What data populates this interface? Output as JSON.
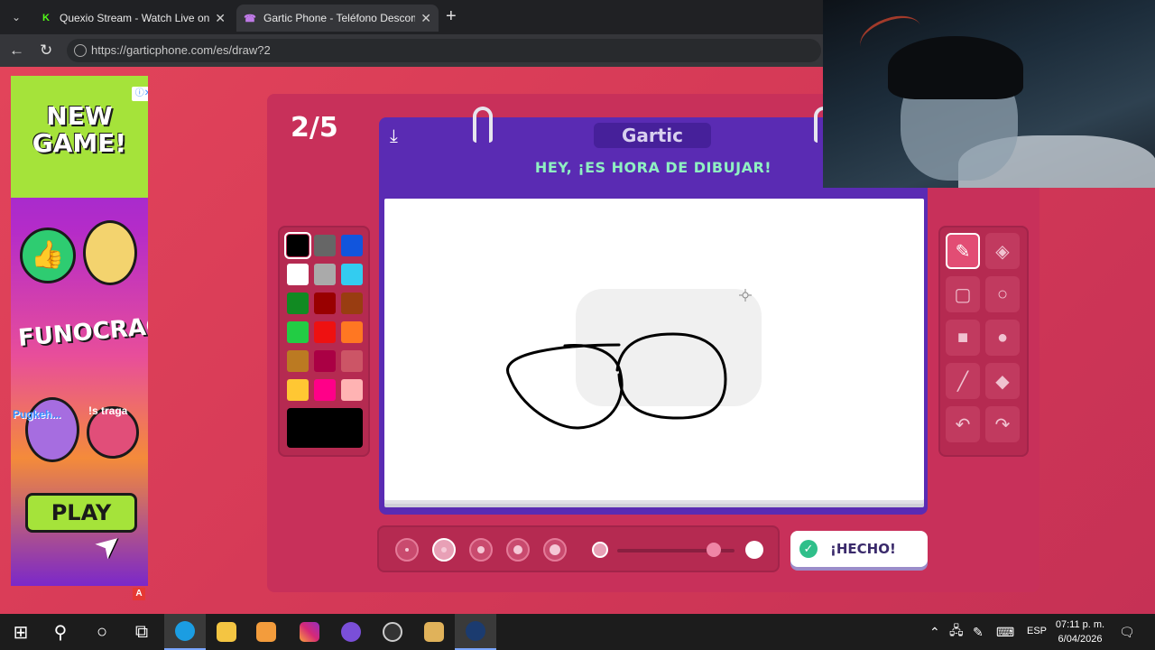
{
  "browser": {
    "tabs": [
      {
        "title": "Quexio Stream - Watch Live on Kic",
        "favicon": "K",
        "favicon_color": "#53fc18",
        "active": false
      },
      {
        "title": "Gartic Phone - Teléfono Descompu",
        "favicon": "☎",
        "favicon_color": "#a25ce0",
        "active": true
      }
    ],
    "url": "https://garticphone.com/es/draw?2"
  },
  "ad": {
    "headline": "NEW GAME!",
    "logo_text": "FUNOCRACY",
    "tag_left": "Pugkeh...",
    "tag_right": "!s traga",
    "play_label": "PLAY",
    "badge": "A"
  },
  "game": {
    "round": "2/5",
    "brand": "Gartic",
    "instruction": "HEY, ¡ES HORA DE DIBUJAR!",
    "done_label": "¡HECHO!",
    "palette": [
      [
        "#000000",
        "#666666",
        "#1155dd"
      ],
      [
        "#ffffff",
        "#aaaaaa",
        "#33ccf0"
      ],
      [
        "#118a22",
        "#990000",
        "#993d11"
      ],
      [
        "#22cc44",
        "#ee1111",
        "#ff7722"
      ],
      [
        "#bb7a22",
        "#aa0044",
        "#cc5566"
      ],
      [
        "#ffc733",
        "#ff0088",
        "#ffb3b3"
      ]
    ],
    "selected_color": "#000000",
    "tools": [
      {
        "icon": "pen-icon",
        "glyph": "✎",
        "selected": true
      },
      {
        "icon": "eraser-icon",
        "glyph": "◈",
        "selected": false
      },
      {
        "icon": "rectangle-outline-icon",
        "glyph": "▢",
        "selected": false
      },
      {
        "icon": "circle-outline-icon",
        "glyph": "○",
        "selected": false
      },
      {
        "icon": "rectangle-fill-icon",
        "glyph": "■",
        "selected": false
      },
      {
        "icon": "circle-fill-icon",
        "glyph": "●",
        "selected": false
      },
      {
        "icon": "line-icon",
        "glyph": "╱",
        "selected": false
      },
      {
        "icon": "bucket-icon",
        "glyph": "◆",
        "selected": false
      },
      {
        "icon": "undo-icon",
        "glyph": "↶",
        "selected": false
      },
      {
        "icon": "redo-icon",
        "glyph": "↷",
        "selected": false
      }
    ],
    "brush_sizes": [
      1,
      2,
      3,
      4,
      5
    ],
    "selected_brush_size": 2,
    "opacity_level": 0.82
  },
  "taskbar": {
    "apps": [
      "start",
      "search",
      "task-view",
      "widgets",
      "edge",
      "file-explorer",
      "media-player",
      "instagram",
      "chat",
      "clock-app",
      "game",
      "steam"
    ],
    "language": "ESP",
    "time": "07:11 p. m.",
    "date": "6/04/2026"
  }
}
